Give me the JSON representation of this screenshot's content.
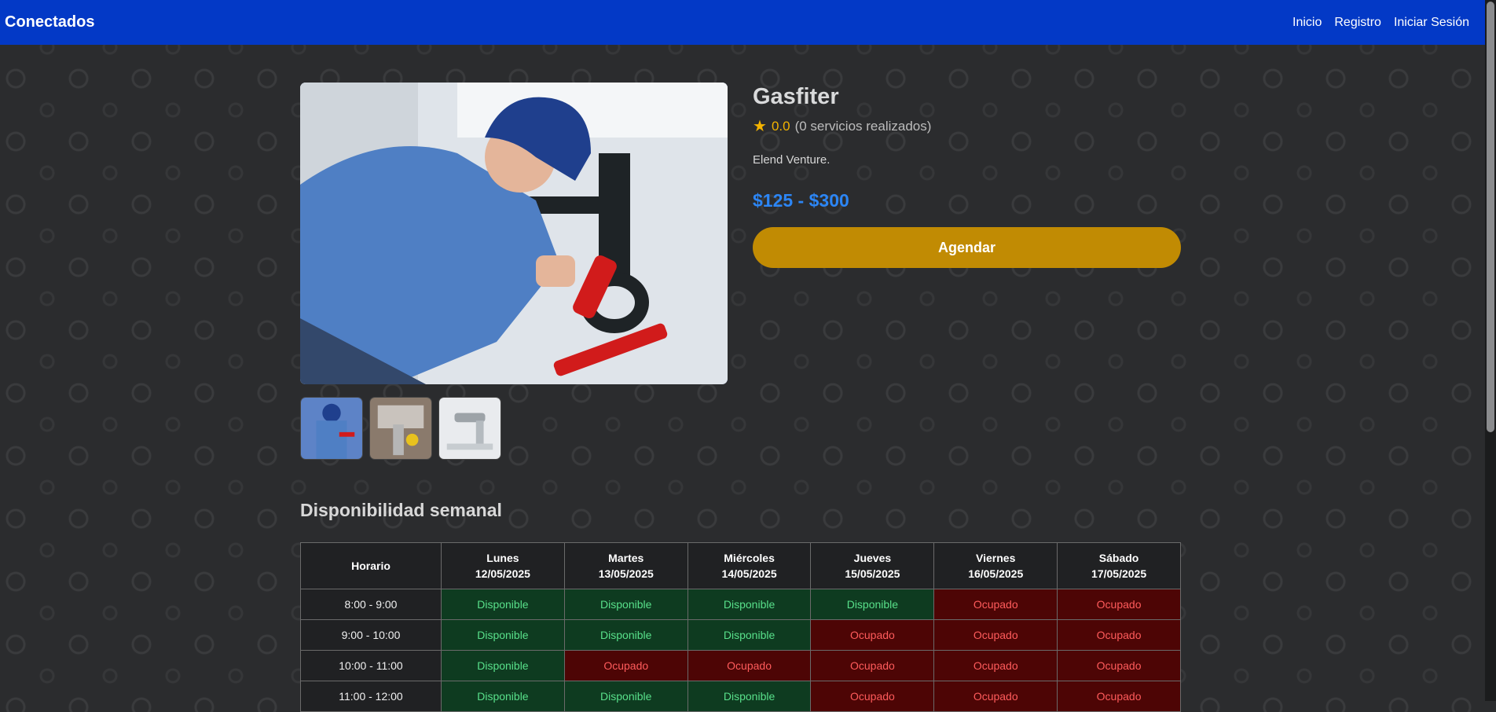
{
  "nav": {
    "brand": "Conectados",
    "links": [
      "Inicio",
      "Registro",
      "Iniciar Sesión"
    ]
  },
  "service": {
    "title": "Gasfiter",
    "rating_value": "0.0",
    "rating_count": "(0 servicios realizados)",
    "company": "Elend Venture.",
    "price": "$125 - $300",
    "book_label": "Agendar"
  },
  "gallery": {
    "thumbnails": [
      "plumber-under-sink",
      "pipe-wrench-repair",
      "faucet-valve"
    ]
  },
  "availability": {
    "title": "Disponibilidad semanal",
    "time_header": "Horario",
    "days": [
      {
        "name": "Lunes",
        "date": "12/05/2025"
      },
      {
        "name": "Martes",
        "date": "13/05/2025"
      },
      {
        "name": "Miércoles",
        "date": "14/05/2025"
      },
      {
        "name": "Jueves",
        "date": "15/05/2025"
      },
      {
        "name": "Viernes",
        "date": "16/05/2025"
      },
      {
        "name": "Sábado",
        "date": "17/05/2025"
      }
    ],
    "rows": [
      {
        "time": "8:00 - 9:00",
        "slots": [
          "Disponible",
          "Disponible",
          "Disponible",
          "Disponible",
          "Ocupado",
          "Ocupado"
        ]
      },
      {
        "time": "9:00 - 10:00",
        "slots": [
          "Disponible",
          "Disponible",
          "Disponible",
          "Ocupado",
          "Ocupado",
          "Ocupado"
        ]
      },
      {
        "time": "10:00 - 11:00",
        "slots": [
          "Disponible",
          "Ocupado",
          "Ocupado",
          "Ocupado",
          "Ocupado",
          "Ocupado"
        ]
      },
      {
        "time": "11:00 - 12:00",
        "slots": [
          "Disponible",
          "Disponible",
          "Disponible",
          "Ocupado",
          "Ocupado",
          "Ocupado"
        ]
      }
    ]
  },
  "colors": {
    "navbar": "#0339c6",
    "accent_price": "#2c86f5",
    "book_button": "#c18b03",
    "available_bg": "#0e3b20",
    "busy_bg": "#4d0505"
  }
}
